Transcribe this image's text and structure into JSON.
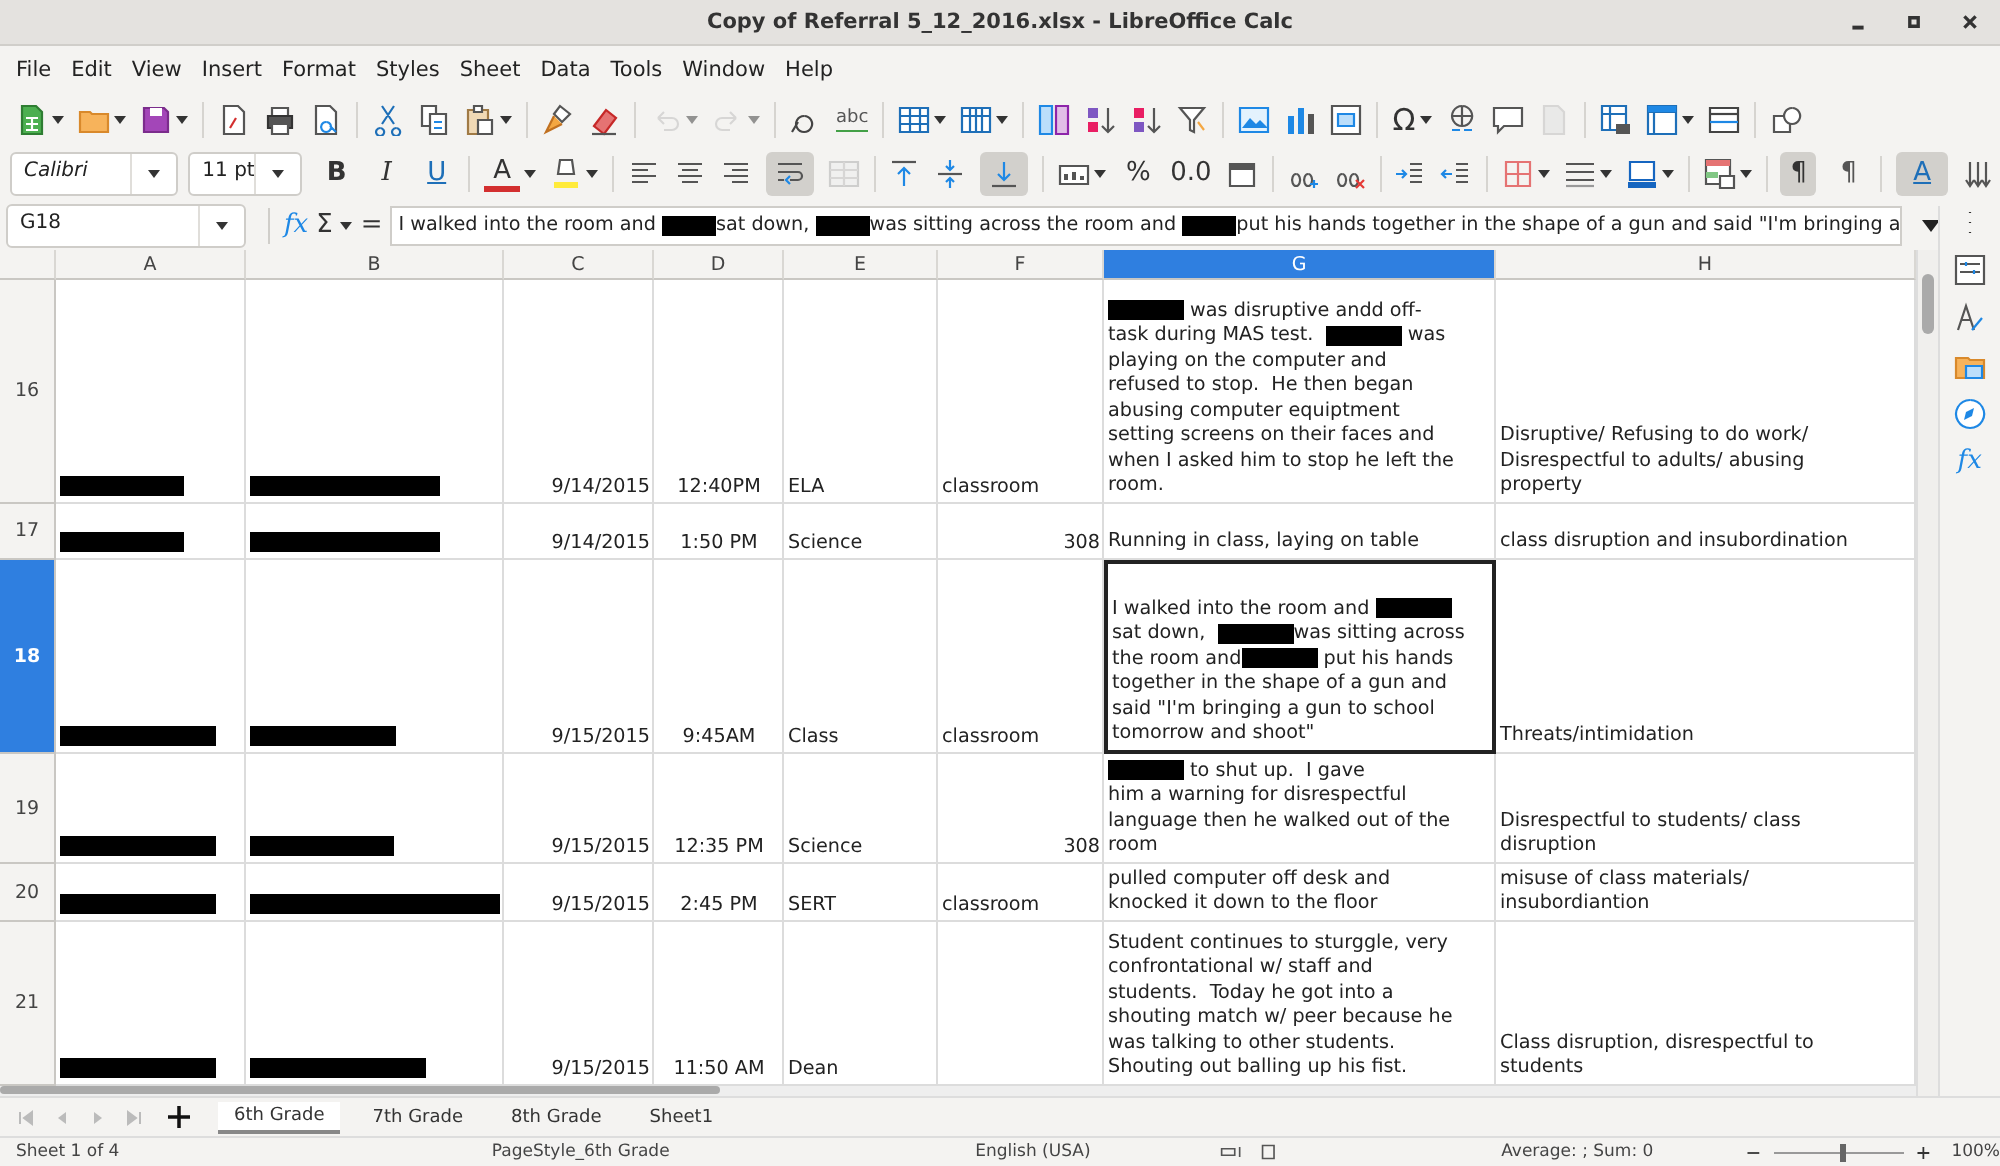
{
  "window": {
    "title": "Copy of Referral 5_12_2016.xlsx - LibreOffice Calc"
  },
  "menu": [
    "File",
    "Edit",
    "View",
    "Insert",
    "Format",
    "Styles",
    "Sheet",
    "Data",
    "Tools",
    "Window",
    "Help"
  ],
  "standard_bar": {
    "glyphs": [
      {
        "label": "abc"
      },
      {
        "label": "Ω"
      }
    ]
  },
  "format_bar": {
    "font_name": "Calibri",
    "font_size": "11 pt",
    "buttons": [
      {
        "label": "B",
        "selected": false
      },
      {
        "label": "I",
        "selected": false
      },
      {
        "label": "U",
        "selected": false
      },
      {
        "label": "A",
        "selected": false
      },
      {
        "label": "%",
        "selected": false
      },
      {
        "label": "0.0",
        "selected": false
      },
      {
        "label": "¶",
        "selected": true
      },
      {
        "label": "¶",
        "selected": false
      },
      {
        "label": "A",
        "selected": true
      }
    ],
    "toggles": {
      "wrap_text": true,
      "align_bottom": true
    }
  },
  "formula_bar": {
    "cell_ref": "G18",
    "function_wizard": "fx",
    "sum": "Σ",
    "equals": "=",
    "content": [
      "I walked into the room and ",
      {
        "kind": "redaction"
      },
      "sat down, ",
      {
        "kind": "redaction"
      },
      "was sitting across the room and ",
      {
        "kind": "redaction"
      },
      "put his hands together in the shape of a gun and said \"I'm bringing a"
    ]
  },
  "columns": [
    {
      "label": "A",
      "selected": false
    },
    {
      "label": "B",
      "selected": false
    },
    {
      "label": "C",
      "selected": false
    },
    {
      "label": "D",
      "selected": false
    },
    {
      "label": "E",
      "selected": false
    },
    {
      "label": "F",
      "selected": false
    },
    {
      "label": "G",
      "selected": true
    },
    {
      "label": "H",
      "selected": false
    }
  ],
  "rows": [
    {
      "number": "16",
      "selected": false,
      "cells": [
        {
          "kind": "redaction"
        },
        {
          "kind": "redaction"
        },
        {
          "kind": "number",
          "text": "9/14/2015"
        },
        {
          "kind": "time",
          "text": "12:40PM"
        },
        {
          "kind": "text",
          "text": "ELA"
        },
        {
          "kind": "text",
          "text": "classroom"
        },
        {
          "kind": "lines",
          "lines": [
            [
              {
                "kind": "redaction"
              },
              " was disruptive andd off-"
            ],
            [
              "task during MAS test.  ",
              {
                "kind": "redaction"
              },
              " was"
            ],
            [
              "playing on the computer and"
            ],
            [
              "refused to stop.  He then began"
            ],
            [
              "abusing computer equiptment"
            ],
            [
              "setting screens on their faces and"
            ],
            [
              "when I asked him to stop he left the"
            ],
            [
              "room."
            ]
          ]
        },
        {
          "kind": "lines",
          "lines": [
            [
              "Disruptive/ Refusing to do work/"
            ],
            [
              "Disrespectful to adults/ abusing"
            ],
            [
              "property"
            ]
          ]
        }
      ]
    },
    {
      "number": "17",
      "selected": false,
      "cells": [
        {
          "kind": "redaction"
        },
        {
          "kind": "redaction"
        },
        {
          "kind": "number",
          "text": "9/14/2015"
        },
        {
          "kind": "time",
          "text": "1:50 PM"
        },
        {
          "kind": "text",
          "text": "Science"
        },
        {
          "kind": "number",
          "text": "308"
        },
        {
          "kind": "lines",
          "lines": [
            [
              "Running in class, laying on table"
            ]
          ]
        },
        {
          "kind": "lines",
          "lines": [
            [
              "class disruption and insubordination"
            ]
          ]
        }
      ]
    },
    {
      "number": "18",
      "selected": true,
      "cells": [
        {
          "kind": "redaction"
        },
        {
          "kind": "redaction"
        },
        {
          "kind": "number",
          "text": "9/15/2015"
        },
        {
          "kind": "time",
          "text": "9:45AM"
        },
        {
          "kind": "text",
          "text": "Class"
        },
        {
          "kind": "text",
          "text": "classroom"
        },
        {
          "kind": "lines",
          "lines": [
            [
              "I walked into the room and ",
              {
                "kind": "redaction"
              }
            ],
            [
              "sat down,  ",
              {
                "kind": "redaction"
              },
              "was sitting across"
            ],
            [
              "the room and",
              {
                "kind": "redaction"
              },
              " put his hands"
            ],
            [
              "together in the shape of a gun and"
            ],
            [
              "said \"I'm bringing a gun to school"
            ],
            [
              "tomorrow and shoot\""
            ]
          ]
        },
        {
          "kind": "lines",
          "lines": [
            [
              "Threats/intimidation"
            ]
          ]
        }
      ]
    },
    {
      "number": "19",
      "selected": false,
      "cells": [
        {
          "kind": "redaction"
        },
        {
          "kind": "redaction"
        },
        {
          "kind": "number",
          "text": "9/15/2015"
        },
        {
          "kind": "time",
          "text": "12:35 PM"
        },
        {
          "kind": "text",
          "text": "Science"
        },
        {
          "kind": "number",
          "text": "308"
        },
        {
          "kind": "lines",
          "lines": [
            [
              {
                "kind": "redaction"
              },
              " to shut up.  I gave"
            ],
            [
              "him a warning for disrespectful"
            ],
            [
              "language then he walked out of the"
            ],
            [
              "room"
            ]
          ]
        },
        {
          "kind": "lines",
          "lines": [
            [
              "Disrespectful to students/ class"
            ],
            [
              "disruption"
            ]
          ]
        }
      ]
    },
    {
      "number": "20",
      "selected": false,
      "cells": [
        {
          "kind": "redaction"
        },
        {
          "kind": "redaction"
        },
        {
          "kind": "number",
          "text": "9/15/2015"
        },
        {
          "kind": "time",
          "text": "2:45 PM"
        },
        {
          "kind": "text",
          "text": "SERT"
        },
        {
          "kind": "text",
          "text": "classroom"
        },
        {
          "kind": "lines",
          "lines": [
            [
              "pulled computer off desk and"
            ],
            [
              "knocked it down to the floor"
            ]
          ]
        },
        {
          "kind": "lines",
          "lines": [
            [
              "misuse of class materials/"
            ],
            [
              "insubordiantion"
            ]
          ]
        }
      ]
    },
    {
      "number": "21",
      "selected": false,
      "cells": [
        {
          "kind": "redaction"
        },
        {
          "kind": "redaction"
        },
        {
          "kind": "number",
          "text": "9/15/2015"
        },
        {
          "kind": "time",
          "text": "11:50 AM"
        },
        {
          "kind": "text",
          "text": "Dean"
        },
        {
          "kind": "empty"
        },
        {
          "kind": "lines",
          "lines": [
            [
              "Student continues to sturggle, very"
            ],
            [
              "confrontational w/ staff and"
            ],
            [
              "students.  Today he got into a"
            ],
            [
              "shouting match w/ peer because he"
            ],
            [
              "was talking to other students."
            ],
            [
              "Shouting out balling up his fist."
            ]
          ]
        },
        {
          "kind": "lines",
          "lines": [
            [
              "Class disruption, disrespectful to"
            ],
            [
              "students"
            ]
          ]
        }
      ]
    }
  ],
  "sheet_tabs": [
    {
      "label": "6th Grade",
      "selected": true
    },
    {
      "label": "7th Grade",
      "selected": false
    },
    {
      "label": "8th Grade",
      "selected": false
    },
    {
      "label": "Sheet1",
      "selected": false
    }
  ],
  "sidebar": {
    "functions_label": "fx"
  },
  "status_bar": {
    "sheet": "Sheet 1 of 4",
    "page_style": "PageStyle_6th Grade",
    "language": "English (USA)",
    "summary": "Average: ; Sum: 0",
    "zoom_slider": {
      "level": 0.5
    },
    "zoom": "100%"
  }
}
